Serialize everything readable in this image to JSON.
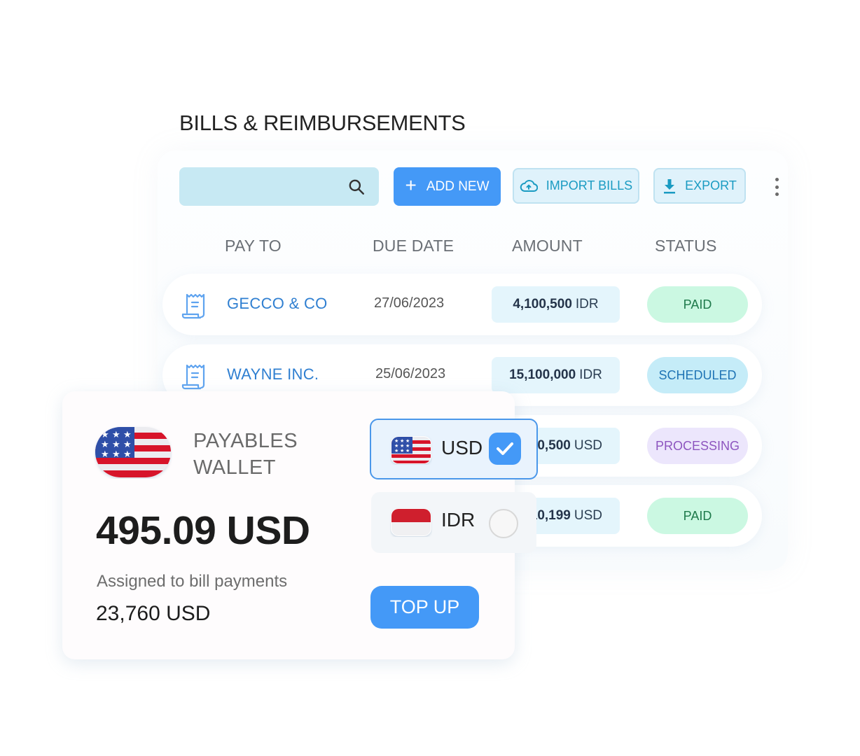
{
  "page": {
    "title": "BILLS & REIMBURSEMENTS"
  },
  "toolbar": {
    "search_value": "",
    "search_placeholder": "",
    "search_icon": "search-icon",
    "add_new_label": "ADD NEW",
    "add_new_icon": "plus-icon",
    "import_label": "IMPORT BILLS",
    "import_icon": "cloud-upload-icon",
    "export_label": "EXPORT",
    "export_icon": "download-icon",
    "more_icon": "more-vertical-icon"
  },
  "table": {
    "columns": [
      "PAY TO",
      "DUE DATE",
      "AMOUNT",
      "STATUS"
    ],
    "rows": [
      {
        "pay_to": "GECCO & CO",
        "due_date": "27/06/2023",
        "amount": "4,100,500",
        "currency": "IDR",
        "status": "PAID"
      },
      {
        "pay_to": "WAYNE INC.",
        "due_date": "25/06/2023",
        "amount": "15,100,000",
        "currency": "IDR",
        "status": "SCHEDULED"
      },
      {
        "pay_to": "",
        "due_date": "",
        "amount": "0,500",
        "currency": "USD",
        "status": "PROCESSING"
      },
      {
        "pay_to": "",
        "due_date": "",
        "amount": "10,199",
        "currency": "USD",
        "status": "PAID"
      }
    ]
  },
  "wallet": {
    "name_line1": "PAYABLES",
    "name_line2": "WALLET",
    "flag": "us-flag-icon",
    "balance": "495.09 USD",
    "assigned_label": "Assigned to bill payments",
    "assigned_value": "23,760 USD",
    "topup_label": "TOP UP"
  },
  "currency_selector": {
    "options": [
      {
        "code": "USD",
        "flag": "us-flag-icon",
        "selected": true
      },
      {
        "code": "IDR",
        "flag": "id-flag-icon",
        "selected": false
      }
    ]
  },
  "colors": {
    "accent": "#4499F7",
    "link": "#2F7FD1",
    "paid_bg": "#CBF8E2",
    "paid_text": "#1E7A4B",
    "scheduled_bg": "#C5ECF8",
    "scheduled_text": "#1F74B5",
    "processing_bg": "#ECE6FC",
    "processing_text": "#8D55BF"
  }
}
